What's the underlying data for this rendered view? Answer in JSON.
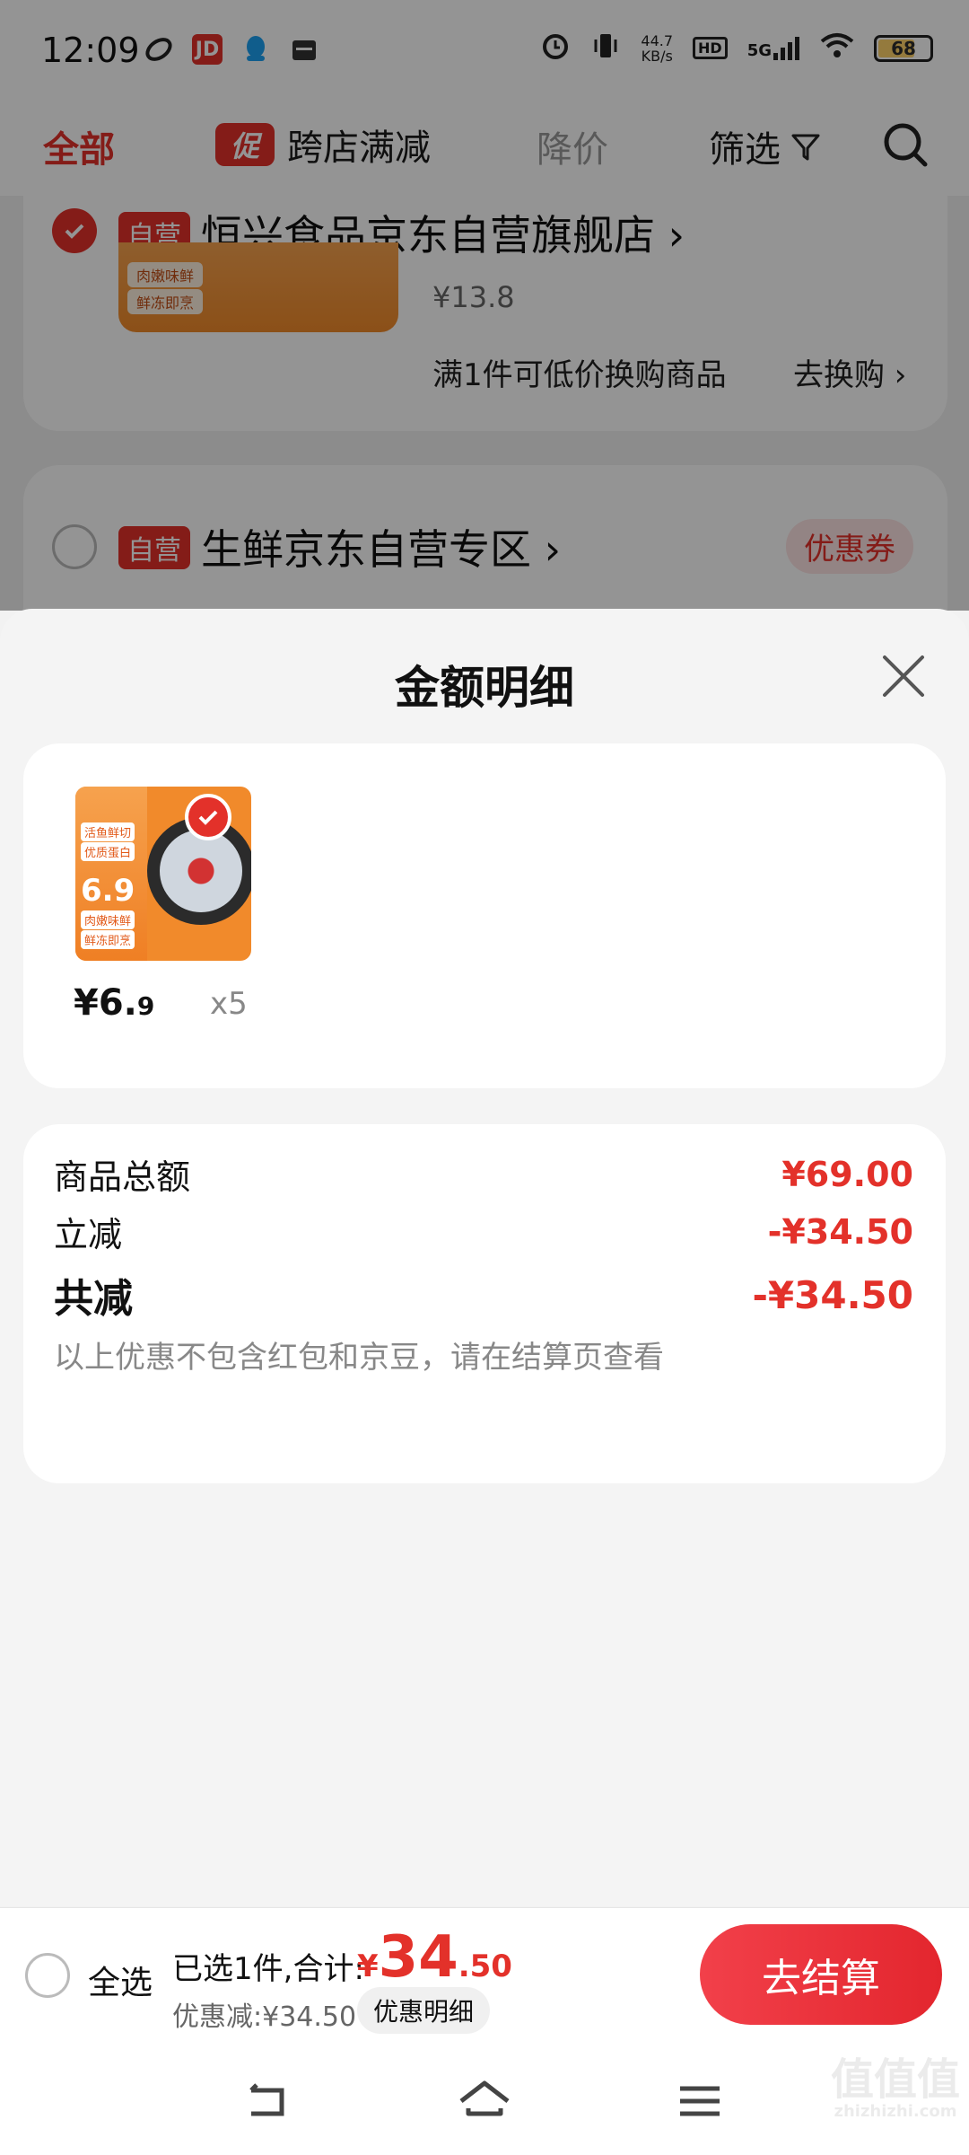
{
  "status_bar": {
    "time": "12:09",
    "network_speed_value": "44.7",
    "network_speed_unit": "KB/s",
    "hd": "HD",
    "signal": "5G",
    "battery": "68",
    "jd_icon_text": "JD",
    "icons": [
      "link-icon",
      "jd-app-icon",
      "qq-icon",
      "calendar-icon",
      "alarm-icon",
      "vibrate-icon",
      "signal-icon",
      "wifi-icon",
      "battery-icon"
    ]
  },
  "filter_bar": {
    "all": "全部",
    "promo_badge": "促",
    "promo": "跨店满减",
    "price_drop": "降价",
    "filter": "筛选"
  },
  "stores": [
    {
      "tag": "自营",
      "name": "恒兴食品京东自营旗舰店 ›",
      "selected": true,
      "thumb_tags": [
        "肉嫩味鲜",
        "鲜冻即烹"
      ],
      "price": "¥13.8",
      "promo_text": "满1件可低价换购商品",
      "promo_link": "去换购 ›"
    },
    {
      "tag": "自营",
      "name": "生鲜京东自营专区 ›",
      "selected": false,
      "coupon": "优惠券"
    }
  ],
  "sheet": {
    "title": "金额明细",
    "product": {
      "price_int": "¥6.",
      "price_dec": "9",
      "quantity": "x5",
      "image_labels": [
        "活鱼鲜切",
        "优质蛋白",
        "肉嫩味鲜",
        "鲜冻即烹"
      ],
      "image_price": "6.9"
    },
    "summary": {
      "goods_total_label": "商品总额",
      "goods_total_value": "¥69.00",
      "instant_off_label": "立减",
      "instant_off_value": "-¥34.50",
      "total_off_label": "共减",
      "total_off_value": "-¥34.50",
      "note": "以上优惠不包含红包和京豆，请在结算页查看"
    }
  },
  "bottom_bar": {
    "select_all": "全选",
    "selected_text": "已选1件,合计:",
    "total_currency": "¥",
    "total_int": "34",
    "total_dec": ".50",
    "discount": "优惠减:¥34.50",
    "detail_button": "优惠明细",
    "checkout": "去结算"
  },
  "watermark": {
    "text": "值值值",
    "url": "zhizhizhi.com"
  },
  "colors": {
    "accent": "#e3312a",
    "checkout_gradient_start": "#f2404a",
    "muted": "#888888"
  }
}
